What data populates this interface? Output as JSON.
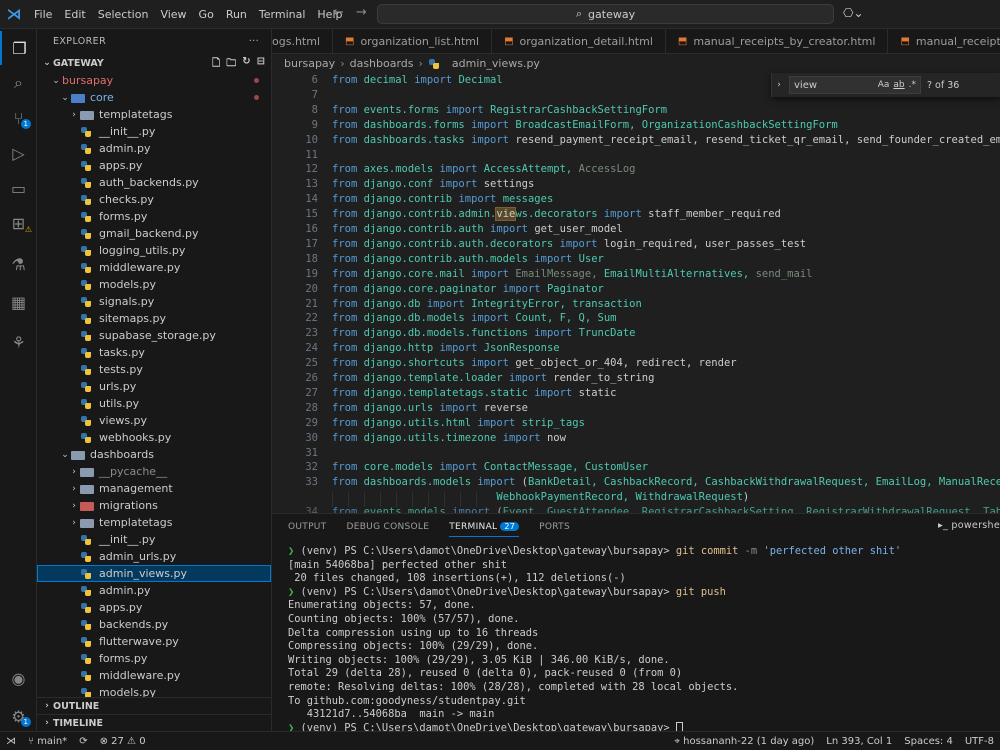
{
  "menu": [
    "File",
    "Edit",
    "Selection",
    "View",
    "Go",
    "Run",
    "Terminal",
    "Help"
  ],
  "search": {
    "text": "gateway"
  },
  "explorer": {
    "title": "EXPLORER",
    "root": "GATEWAY",
    "tree": [
      {
        "label": "bursapay",
        "kind": "folder-red",
        "indent": 1,
        "open": true,
        "modified": true
      },
      {
        "label": "core",
        "kind": "folder-blue",
        "indent": 2,
        "open": true,
        "modified": true
      },
      {
        "label": "templatetags",
        "kind": "folder",
        "indent": 3,
        "open": false
      },
      {
        "label": "__init__.py",
        "kind": "py",
        "indent": 3
      },
      {
        "label": "admin.py",
        "kind": "py",
        "indent": 3
      },
      {
        "label": "apps.py",
        "kind": "py",
        "indent": 3
      },
      {
        "label": "auth_backends.py",
        "kind": "py",
        "indent": 3
      },
      {
        "label": "checks.py",
        "kind": "py",
        "indent": 3
      },
      {
        "label": "forms.py",
        "kind": "py",
        "indent": 3
      },
      {
        "label": "gmail_backend.py",
        "kind": "py",
        "indent": 3
      },
      {
        "label": "logging_utils.py",
        "kind": "py",
        "indent": 3
      },
      {
        "label": "middleware.py",
        "kind": "py",
        "indent": 3
      },
      {
        "label": "models.py",
        "kind": "py",
        "indent": 3
      },
      {
        "label": "signals.py",
        "kind": "py",
        "indent": 3
      },
      {
        "label": "sitemaps.py",
        "kind": "py",
        "indent": 3
      },
      {
        "label": "supabase_storage.py",
        "kind": "py",
        "indent": 3
      },
      {
        "label": "tasks.py",
        "kind": "py",
        "indent": 3
      },
      {
        "label": "tests.py",
        "kind": "py",
        "indent": 3
      },
      {
        "label": "urls.py",
        "kind": "py",
        "indent": 3
      },
      {
        "label": "utils.py",
        "kind": "py",
        "indent": 3
      },
      {
        "label": "views.py",
        "kind": "py",
        "indent": 3
      },
      {
        "label": "webhooks.py",
        "kind": "py",
        "indent": 3
      },
      {
        "label": "dashboards",
        "kind": "folder",
        "indent": 2,
        "open": true
      },
      {
        "label": "__pycache__",
        "kind": "folder",
        "indent": 3,
        "open": false,
        "dim": true
      },
      {
        "label": "management",
        "kind": "folder",
        "indent": 3,
        "open": false
      },
      {
        "label": "migrations",
        "kind": "folder-red",
        "indent": 3,
        "open": false
      },
      {
        "label": "templatetags",
        "kind": "folder",
        "indent": 3,
        "open": false
      },
      {
        "label": "__init__.py",
        "kind": "py",
        "indent": 3
      },
      {
        "label": "admin_urls.py",
        "kind": "py",
        "indent": 3
      },
      {
        "label": "admin_views.py",
        "kind": "py",
        "indent": 3,
        "selected": true
      },
      {
        "label": "admin.py",
        "kind": "py",
        "indent": 3
      },
      {
        "label": "apps.py",
        "kind": "py",
        "indent": 3
      },
      {
        "label": "backends.py",
        "kind": "py",
        "indent": 3
      },
      {
        "label": "flutterwave.py",
        "kind": "py",
        "indent": 3
      },
      {
        "label": "forms.py",
        "kind": "py",
        "indent": 3
      },
      {
        "label": "middleware.py",
        "kind": "py",
        "indent": 3
      },
      {
        "label": "models.py",
        "kind": "py",
        "indent": 3
      }
    ],
    "outline": "OUTLINE",
    "timeline": "TIMELINE"
  },
  "tabs": [
    "ogs.html",
    "organization_list.html",
    "organization_detail.html",
    "manual_receipts_by_creator.html",
    "manual_receipt_creators.html"
  ],
  "breadcrumb": [
    "bursapay",
    "dashboards",
    "admin_views.py"
  ],
  "find": {
    "query": "view",
    "opt_case": "Aa",
    "opt_word": "ab",
    "opt_regex": ".*",
    "count": "? of 36"
  },
  "code": [
    {
      "n": "6",
      "t": [
        [
          "kw",
          "from "
        ],
        [
          "mod",
          "decimal "
        ],
        [
          "kw",
          "import "
        ],
        [
          "mod",
          "Decimal"
        ]
      ]
    },
    {
      "n": "7",
      "t": []
    },
    {
      "n": "8",
      "t": [
        [
          "kw",
          "from "
        ],
        [
          "mod",
          "events.forms "
        ],
        [
          "kw",
          "import "
        ],
        [
          "mod",
          "RegistrarCashbackSettingForm"
        ]
      ]
    },
    {
      "n": "9",
      "t": [
        [
          "kw",
          "from "
        ],
        [
          "mod",
          "dashboards.forms "
        ],
        [
          "kw",
          "import "
        ],
        [
          "mod",
          "BroadcastEmailForm, OrganizationCashbackSettingForm"
        ]
      ]
    },
    {
      "n": "10",
      "t": [
        [
          "kw",
          "from "
        ],
        [
          "mod",
          "dashboards.tasks "
        ],
        [
          "kw",
          "import "
        ],
        [
          "",
          "resend_payment_receipt_email, resend_ticket_qr_email, send_founder_created_email,"
        ]
      ]
    },
    {
      "n": "11",
      "t": []
    },
    {
      "n": "12",
      "t": [
        [
          "kw",
          "from "
        ],
        [
          "mod",
          "axes.models "
        ],
        [
          "kw",
          "import "
        ],
        [
          "mod",
          "AccessAttempt, "
        ],
        [
          "dim",
          "AccessLog"
        ]
      ]
    },
    {
      "n": "13",
      "t": [
        [
          "kw",
          "from "
        ],
        [
          "mod",
          "django.conf "
        ],
        [
          "kw",
          "import "
        ],
        [
          "",
          "settings"
        ]
      ]
    },
    {
      "n": "14",
      "t": [
        [
          "kw",
          "from "
        ],
        [
          "mod",
          "django.contrib "
        ],
        [
          "kw",
          "import "
        ],
        [
          "mod",
          "messages"
        ]
      ]
    },
    {
      "n": "15",
      "t": [
        [
          "kw",
          "from "
        ],
        [
          "mod",
          "django.contrib.admin."
        ],
        [
          "hl",
          "vie"
        ],
        [
          "mod",
          "ws.decorators "
        ],
        [
          "kw",
          "import "
        ],
        [
          "",
          "staff_member_required"
        ]
      ]
    },
    {
      "n": "16",
      "t": [
        [
          "kw",
          "from "
        ],
        [
          "mod",
          "django.contrib.auth "
        ],
        [
          "kw",
          "import "
        ],
        [
          "",
          "get_user_model"
        ]
      ]
    },
    {
      "n": "17",
      "t": [
        [
          "kw",
          "from "
        ],
        [
          "mod",
          "django.contrib.auth.decorators "
        ],
        [
          "kw",
          "import "
        ],
        [
          "",
          "login_required, user_passes_test"
        ]
      ]
    },
    {
      "n": "18",
      "t": [
        [
          "kw",
          "from "
        ],
        [
          "mod",
          "django.contrib.auth.models "
        ],
        [
          "kw",
          "import "
        ],
        [
          "mod",
          "User"
        ]
      ]
    },
    {
      "n": "19",
      "t": [
        [
          "kw",
          "from "
        ],
        [
          "mod",
          "django.core.mail "
        ],
        [
          "kw",
          "import "
        ],
        [
          "dim",
          "EmailMessage, "
        ],
        [
          "mod",
          "EmailMultiAlternatives, "
        ],
        [
          "dim",
          "send_mail"
        ]
      ]
    },
    {
      "n": "20",
      "t": [
        [
          "kw",
          "from "
        ],
        [
          "mod",
          "django.core.paginator "
        ],
        [
          "kw",
          "import "
        ],
        [
          "mod",
          "Paginator"
        ]
      ]
    },
    {
      "n": "21",
      "t": [
        [
          "kw",
          "from "
        ],
        [
          "mod",
          "django.db "
        ],
        [
          "kw",
          "import "
        ],
        [
          "mod",
          "IntegrityError, transaction"
        ]
      ]
    },
    {
      "n": "22",
      "t": [
        [
          "kw",
          "from "
        ],
        [
          "mod",
          "django.db.models "
        ],
        [
          "kw",
          "import "
        ],
        [
          "mod",
          "Count, F, Q, Sum"
        ]
      ]
    },
    {
      "n": "23",
      "t": [
        [
          "kw",
          "from "
        ],
        [
          "mod",
          "django.db.models.functions "
        ],
        [
          "kw",
          "import "
        ],
        [
          "mod",
          "TruncDate"
        ]
      ]
    },
    {
      "n": "24",
      "t": [
        [
          "kw",
          "from "
        ],
        [
          "mod",
          "django.http "
        ],
        [
          "kw",
          "import "
        ],
        [
          "mod",
          "JsonResponse"
        ]
      ]
    },
    {
      "n": "25",
      "t": [
        [
          "kw",
          "from "
        ],
        [
          "mod",
          "django.shortcuts "
        ],
        [
          "kw",
          "import "
        ],
        [
          "",
          "get_object_or_404, redirect, render"
        ]
      ]
    },
    {
      "n": "26",
      "t": [
        [
          "kw",
          "from "
        ],
        [
          "mod",
          "django.template.loader "
        ],
        [
          "kw",
          "import "
        ],
        [
          "",
          "render_to_string"
        ]
      ]
    },
    {
      "n": "27",
      "t": [
        [
          "kw",
          "from "
        ],
        [
          "mod",
          "django.templatetags.static "
        ],
        [
          "kw",
          "import "
        ],
        [
          "",
          "static"
        ]
      ]
    },
    {
      "n": "28",
      "t": [
        [
          "kw",
          "from "
        ],
        [
          "mod",
          "django.urls "
        ],
        [
          "kw",
          "import "
        ],
        [
          "",
          "reverse"
        ]
      ]
    },
    {
      "n": "29",
      "t": [
        [
          "kw",
          "from "
        ],
        [
          "mod",
          "django.utils.html "
        ],
        [
          "kw",
          "import "
        ],
        [
          "mod",
          "strip_tags"
        ]
      ]
    },
    {
      "n": "30",
      "t": [
        [
          "kw",
          "from "
        ],
        [
          "mod",
          "django.utils.timezone "
        ],
        [
          "kw",
          "import "
        ],
        [
          "",
          "now"
        ]
      ]
    },
    {
      "n": "31",
      "t": []
    },
    {
      "n": "32",
      "t": [
        [
          "kw",
          "from "
        ],
        [
          "mod",
          "core.models "
        ],
        [
          "kw",
          "import "
        ],
        [
          "mod",
          "ContactMessage, CustomUser"
        ]
      ]
    },
    {
      "n": "33",
      "t": [
        [
          "kw",
          "from "
        ],
        [
          "mod",
          "dashboards.models "
        ],
        [
          "kw",
          "import "
        ],
        [
          "",
          "("
        ],
        [
          "mod",
          "BankDetail, CashbackRecord, CashbackWithdrawalRequest, EmailLog, ManualReceiptLo"
        ]
      ]
    },
    {
      "n": "",
      "t": [
        [
          "",
          "                          "
        ],
        [
          "mod",
          "WebhookPaymentRecord, WithdrawalRequest"
        ],
        [
          "",
          ")"
        ]
      ]
    },
    {
      "n": "34",
      "t": [
        [
          "kw",
          "from "
        ],
        [
          "mod",
          "events.models "
        ],
        [
          "kw",
          "import "
        ],
        [
          "",
          "("
        ],
        [
          "mod",
          "Event, GuestAttendee, RegistrarCashbackSetting, RegistrarWithdrawalRequest, TableRes"
        ]
      ]
    }
  ],
  "panel": {
    "tabs": [
      "OUTPUT",
      "DEBUG CONSOLE",
      "TERMINAL",
      "PORTS"
    ],
    "terminal_badge": "27",
    "shell": "powershe",
    "lines": [
      {
        "prompt": true,
        "path": "(venv) PS C:\\Users\\damot\\OneDrive\\Desktop\\gateway\\bursapay> ",
        "cmd": "git commit",
        "rest": " -m ",
        "str": "'perfected other shit'"
      },
      {
        "text": "[main 54068ba] perfected other shit"
      },
      {
        "text": " 20 files changed, 108 insertions(+), 112 deletions(-)"
      },
      {
        "prompt": true,
        "path": "(venv) PS C:\\Users\\damot\\OneDrive\\Desktop\\gateway\\bursapay> ",
        "cmd": "git push",
        "rest": "",
        "str": ""
      },
      {
        "text": "Enumerating objects: 57, done."
      },
      {
        "text": "Counting objects: 100% (57/57), done."
      },
      {
        "text": "Delta compression using up to 16 threads"
      },
      {
        "text": "Compressing objects: 100% (29/29), done."
      },
      {
        "text": "Writing objects: 100% (29/29), 3.05 KiB | 346.00 KiB/s, done."
      },
      {
        "text": "Total 29 (delta 28), reused 0 (delta 0), pack-reused 0 (from 0)"
      },
      {
        "text": "remote: Resolving deltas: 100% (28/28), completed with 28 local objects."
      },
      {
        "text": "To github.com:goodyness/studentpay.git"
      },
      {
        "text": "   43121d7..54068ba  main -> main"
      },
      {
        "prompt": true,
        "path": "(venv) PS C:\\Users\\damot\\OneDrive\\Desktop\\gateway\\bursapay> ",
        "cmd": "",
        "rest": "",
        "str": "",
        "cursor": true
      }
    ]
  },
  "status": {
    "branch": "main*",
    "errors": "27",
    "warnings": "0",
    "blame": "hossananh-22 (1 day ago)",
    "position": "Ln 393, Col 1",
    "spaces": "Spaces: 4",
    "encoding": "UTF-8"
  }
}
